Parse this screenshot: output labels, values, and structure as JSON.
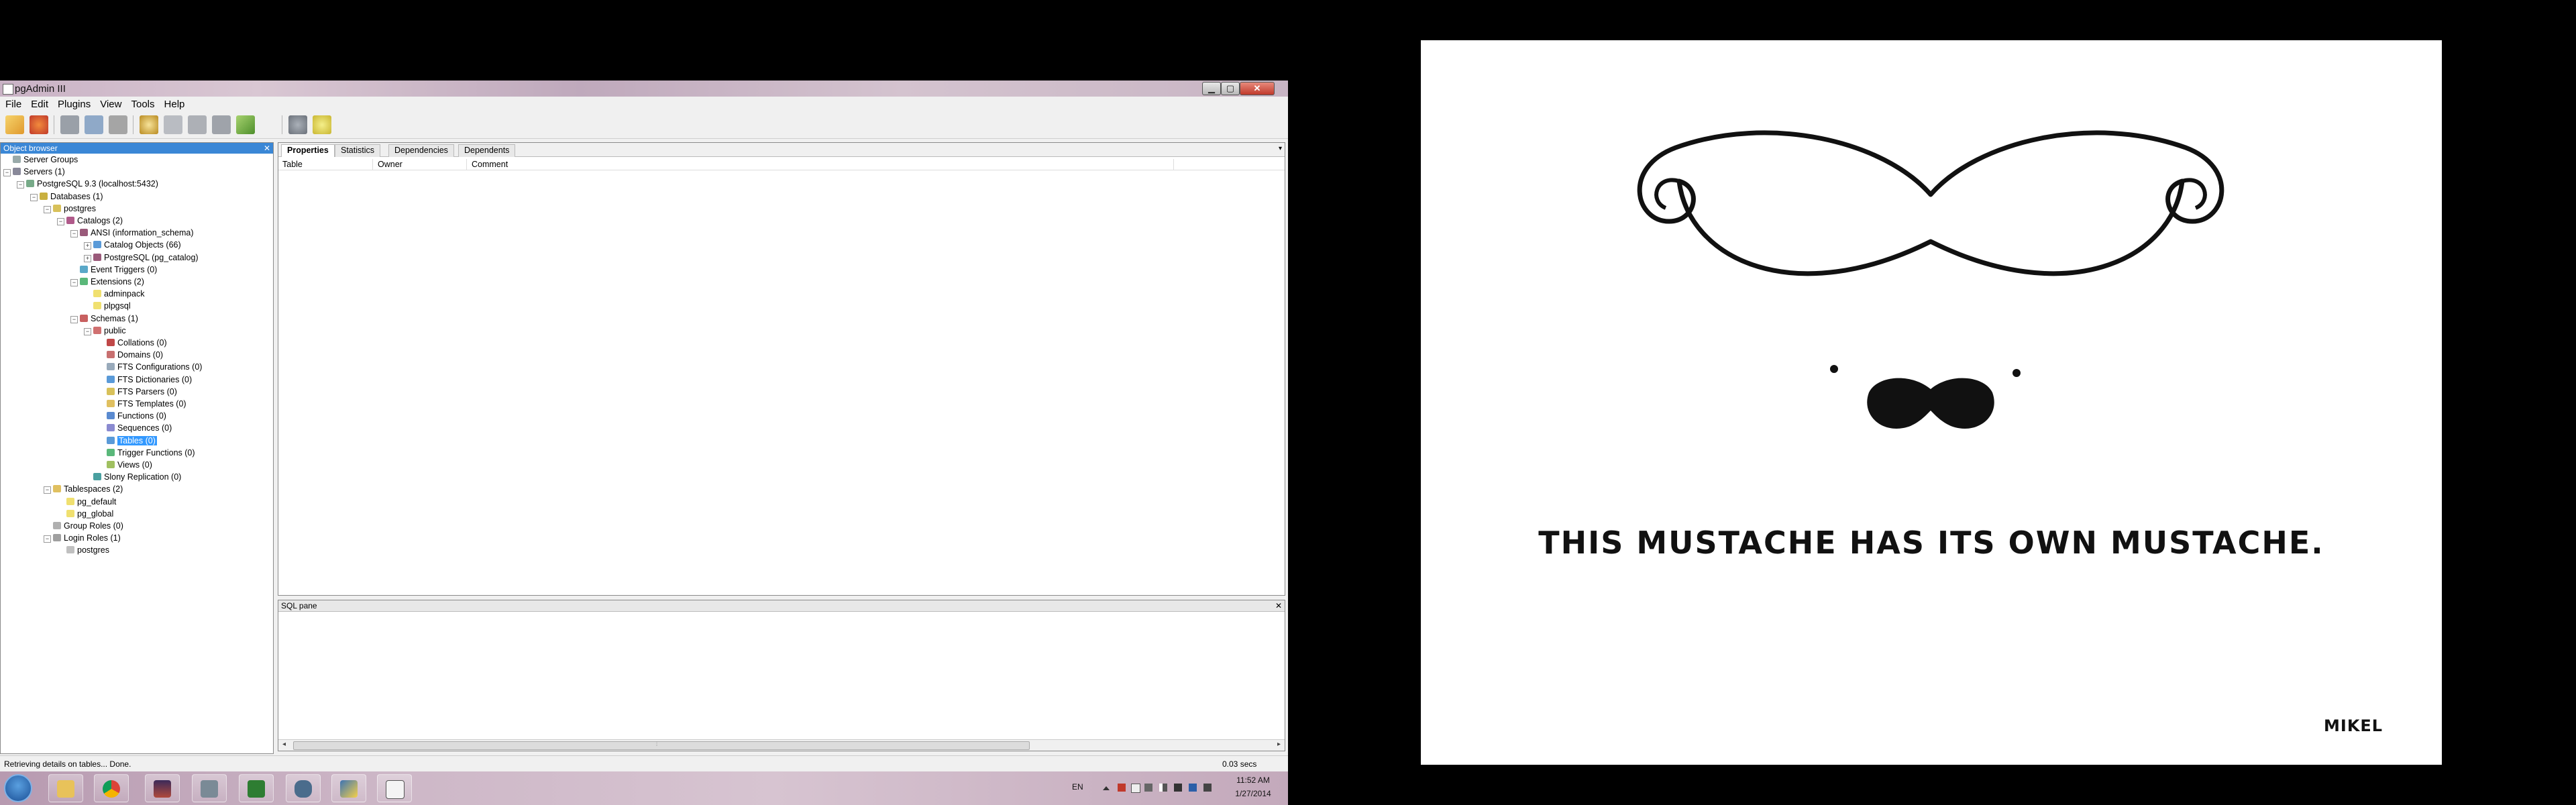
{
  "window": {
    "title": "pgAdmin III",
    "controls": {
      "minimize": "▁",
      "maximize": "▢",
      "close": "✕"
    }
  },
  "menu": [
    "File",
    "Edit",
    "Plugins",
    "View",
    "Tools",
    "Help"
  ],
  "object_browser": {
    "title": "Object browser",
    "close": "✕",
    "tree": [
      {
        "label": "Server Groups",
        "icon": "server-groups-icon",
        "expander": ""
      },
      {
        "label": "Servers (1)",
        "icon": "servers-icon",
        "expander": "−"
      },
      {
        "label": "PostgreSQL 9.3 (localhost:5432)",
        "icon": "server-icon",
        "expander": "−"
      },
      {
        "label": "Databases (1)",
        "icon": "databases-icon",
        "expander": "−"
      },
      {
        "label": "postgres",
        "icon": "database-icon",
        "expander": "−"
      },
      {
        "label": "Catalogs (2)",
        "icon": "catalogs-icon",
        "expander": "−"
      },
      {
        "label": "ANSI (information_schema)",
        "icon": "catalog-icon",
        "expander": "−"
      },
      {
        "label": "Catalog Objects (66)",
        "icon": "catalog-objects-icon",
        "expander": "+"
      },
      {
        "label": "PostgreSQL (pg_catalog)",
        "icon": "catalog-icon",
        "expander": "+"
      },
      {
        "label": "Event Triggers (0)",
        "icon": "event-triggers-icon",
        "expander": ""
      },
      {
        "label": "Extensions (2)",
        "icon": "extensions-icon",
        "expander": "−"
      },
      {
        "label": "adminpack",
        "icon": "extension-icon",
        "expander": ""
      },
      {
        "label": "plpgsql",
        "icon": "extension-icon",
        "expander": ""
      },
      {
        "label": "Schemas (1)",
        "icon": "schemas-icon",
        "expander": "−"
      },
      {
        "label": "public",
        "icon": "schema-icon",
        "expander": "−"
      },
      {
        "label": "Collations (0)",
        "icon": "collations-icon",
        "expander": ""
      },
      {
        "label": "Domains (0)",
        "icon": "domains-icon",
        "expander": ""
      },
      {
        "label": "FTS Configurations (0)",
        "icon": "fts-configurations-icon",
        "expander": ""
      },
      {
        "label": "FTS Dictionaries (0)",
        "icon": "fts-dictionaries-icon",
        "expander": ""
      },
      {
        "label": "FTS Parsers (0)",
        "icon": "fts-parsers-icon",
        "expander": ""
      },
      {
        "label": "FTS Templates (0)",
        "icon": "fts-templates-icon",
        "expander": ""
      },
      {
        "label": "Functions (0)",
        "icon": "functions-icon",
        "expander": ""
      },
      {
        "label": "Sequences (0)",
        "icon": "sequences-icon",
        "expander": ""
      },
      {
        "label": "Tables (0)",
        "icon": "tables-icon",
        "expander": "",
        "selected": true
      },
      {
        "label": "Trigger Functions (0)",
        "icon": "trigger-functions-icon",
        "expander": ""
      },
      {
        "label": "Views (0)",
        "icon": "views-icon",
        "expander": ""
      },
      {
        "label": "Slony Replication (0)",
        "icon": "slony-icon",
        "expander": ""
      },
      {
        "label": "Tablespaces (2)",
        "icon": "tablespaces-icon",
        "expander": "−"
      },
      {
        "label": "pg_default",
        "icon": "tablespace-icon",
        "expander": ""
      },
      {
        "label": "pg_global",
        "icon": "tablespace-icon",
        "expander": ""
      },
      {
        "label": "Group Roles (0)",
        "icon": "group-roles-icon",
        "expander": ""
      },
      {
        "label": "Login Roles (1)",
        "icon": "login-roles-icon",
        "expander": "−"
      },
      {
        "label": "postgres",
        "icon": "login-role-icon",
        "expander": ""
      }
    ]
  },
  "properties": {
    "tabs": [
      "Properties",
      "Statistics",
      "Dependencies",
      "Dependents"
    ],
    "active_tab": "Properties",
    "dropdown": "▾",
    "columns": [
      "Table",
      "Owner",
      "Comment"
    ]
  },
  "sql_pane": {
    "title": "SQL pane",
    "close": "✕",
    "scroll_left": "◂",
    "scroll_right": "▸",
    "scroll_grip": "⦙"
  },
  "status": {
    "message": "Retrieving details on tables... Done.",
    "time": "0.03 secs"
  },
  "taskbar": {
    "apps": [
      "windows-explorer-icon",
      "chrome-icon",
      "media-player-icon",
      "download-icon",
      "excel-icon",
      "pgadmin-icon",
      "python-icon",
      "calendar-icon"
    ],
    "tray": {
      "language": "EN",
      "time": "11:52 AM",
      "date": "1/27/2014"
    }
  },
  "comic": {
    "caption": "THIS MUSTACHE HAS ITS OWN MUSTACHE.",
    "signature": "MIKEL"
  },
  "colors": {
    "selection": "#3399ff",
    "object_browser_header": "#3a87d6",
    "taskbar": "#cdb7c7"
  }
}
